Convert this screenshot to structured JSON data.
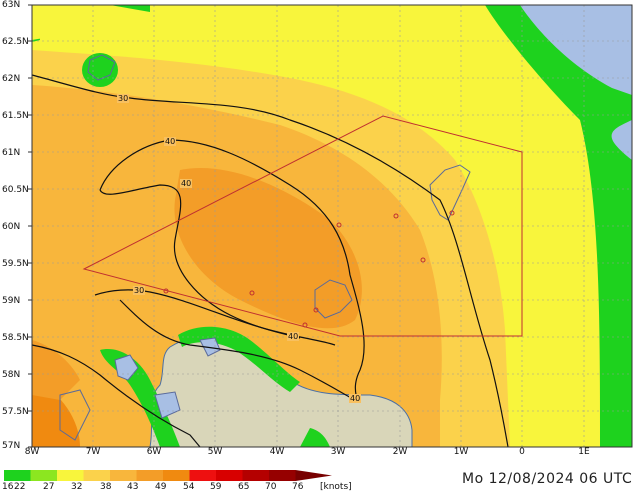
{
  "latitude_labels": [
    "63N",
    "62.5N",
    "62N",
    "61.5N",
    "61N",
    "60.5N",
    "60N",
    "59.5N",
    "59N",
    "58.5N",
    "58N",
    "57.5N",
    "57N"
  ],
  "longitude_labels": [
    "8W",
    "7W",
    "6W",
    "5W",
    "4W",
    "3W",
    "2W",
    "1W",
    "0",
    "1E"
  ],
  "contour_labels": [
    "30",
    "40",
    "40",
    "30",
    "40",
    "40"
  ],
  "legend": {
    "ticks": [
      "16",
      "22",
      "27",
      "32",
      "38",
      "43",
      "49",
      "54",
      "59",
      "65",
      "70",
      "76",
      "[knots]"
    ],
    "colors": [
      "#1ed21e",
      "#8ce620",
      "#f8f53c",
      "#fbd24b",
      "#f8b63c",
      "#f39d28",
      "#f08a10",
      "#ee1010",
      "#d80000",
      "#b40000",
      "#960000",
      "#780000"
    ]
  },
  "timestamp": "Mo 12/08/2024 06 UTC"
}
